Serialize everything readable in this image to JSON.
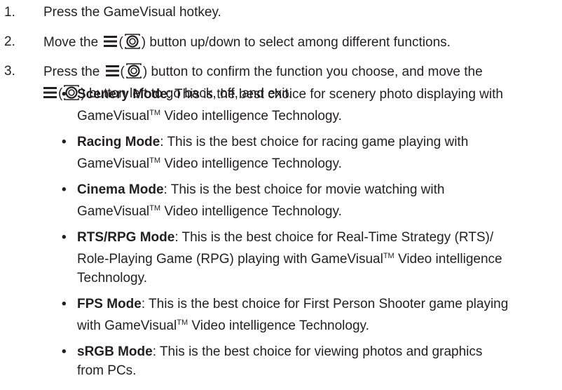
{
  "steps": [
    {
      "number": "1.",
      "text": "Press the GameVisual hotkey."
    },
    {
      "number": "2.",
      "pre": "Move the",
      "post": "button up/down to select among different functions."
    },
    {
      "number": "3.",
      "pre": "Press the",
      "mid": "button to confirm the function you choose, and move the",
      "post": "button left to go back, off, and exit."
    }
  ],
  "icons": {
    "menu": "menu-lines-icon",
    "joystick": "five-way-joystick-icon"
  },
  "tm": "TM",
  "modes": [
    {
      "term": "Scenery Mode",
      "lines": [
        ": This is the best choice for scenery photo displaying with",
        "GameVisual",
        " Video intelligence Technology."
      ]
    },
    {
      "term": "Racing Mode",
      "lines": [
        ": This is the best choice for racing game playing with",
        "GameVisual",
        " Video intelligence Technology."
      ]
    },
    {
      "term": "Cinema Mode",
      "lines": [
        ": This is the best choice for movie watching with",
        "GameVisual",
        " Video intelligence Technology."
      ]
    },
    {
      "term": "RTS/RPG Mode",
      "lines": [
        ": This is the best choice for Real-Time Strategy (RTS)/",
        "Role-Playing Game (RPG) playing with GameVisual",
        " Video intelligence",
        "Technology."
      ]
    },
    {
      "term": "FPS Mode",
      "lines": [
        ": This is the best choice for First Person Shooter game playing",
        "with GameVisual",
        " Video intelligence Technology."
      ]
    },
    {
      "term": "sRGB Mode",
      "lines": [
        ": This is the best choice for viewing photos and graphics",
        "from PCs."
      ]
    }
  ]
}
